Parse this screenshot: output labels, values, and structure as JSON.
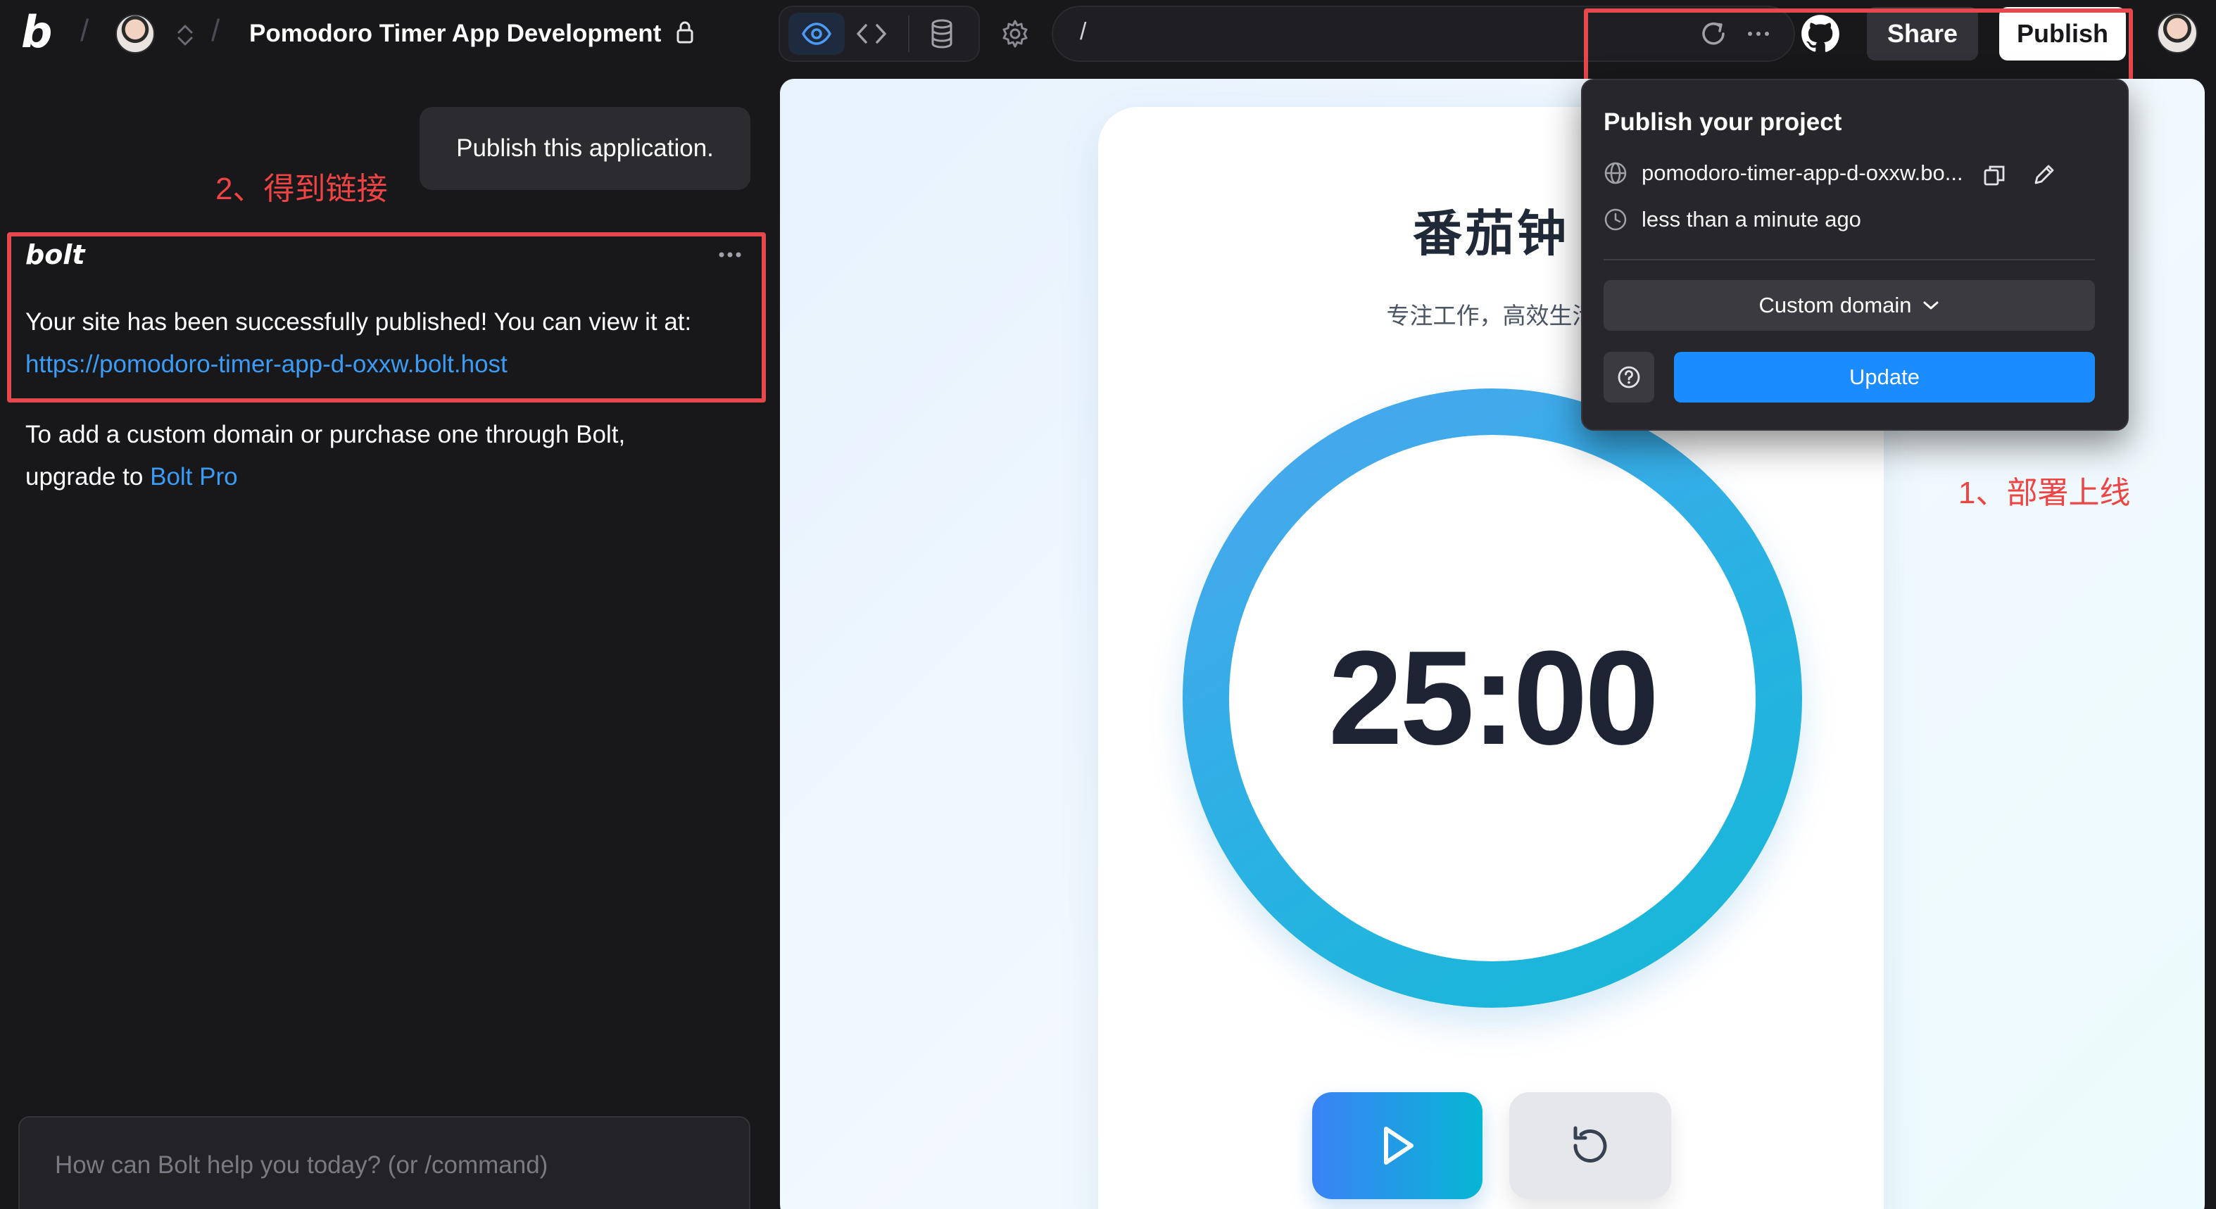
{
  "header": {
    "logo": "b",
    "project_title": "Pomodoro Timer App Development",
    "address_path": "/",
    "share_label": "Share",
    "publish_label": "Publish"
  },
  "chat": {
    "user_message": "Publish this application.",
    "assistant_name": "bolt",
    "published_line": "Your site has been successfully published! You can view it at:",
    "published_url": "https://pomodoro-timer-app-d-oxxw.bolt.host",
    "custom_domain_line1": "To add a custom domain or purchase one through Bolt,",
    "custom_domain_line2_prefix": "upgrade to ",
    "custom_domain_link": "Bolt Pro",
    "input_placeholder": "How can Bolt help you today? (or /command)"
  },
  "annotations": {
    "step1": "1、部署上线",
    "step2": "2、得到链接"
  },
  "preview": {
    "app_title": "番茄钟",
    "app_subtitle": "专注工作，高效生活",
    "time": "25:00"
  },
  "publish_popover": {
    "title": "Publish your project",
    "url": "pomodoro-timer-app-d-oxxw.bo...",
    "updated": "less than a minute ago",
    "custom_domain_label": "Custom domain",
    "update_label": "Update"
  },
  "colors": {
    "accent_blue": "#1a8cff",
    "link_blue": "#3b9cf6",
    "annotation_red": "#e5484d",
    "timer_ring_start": "#4ea5f0",
    "timer_ring_end": "#14b8d6"
  }
}
